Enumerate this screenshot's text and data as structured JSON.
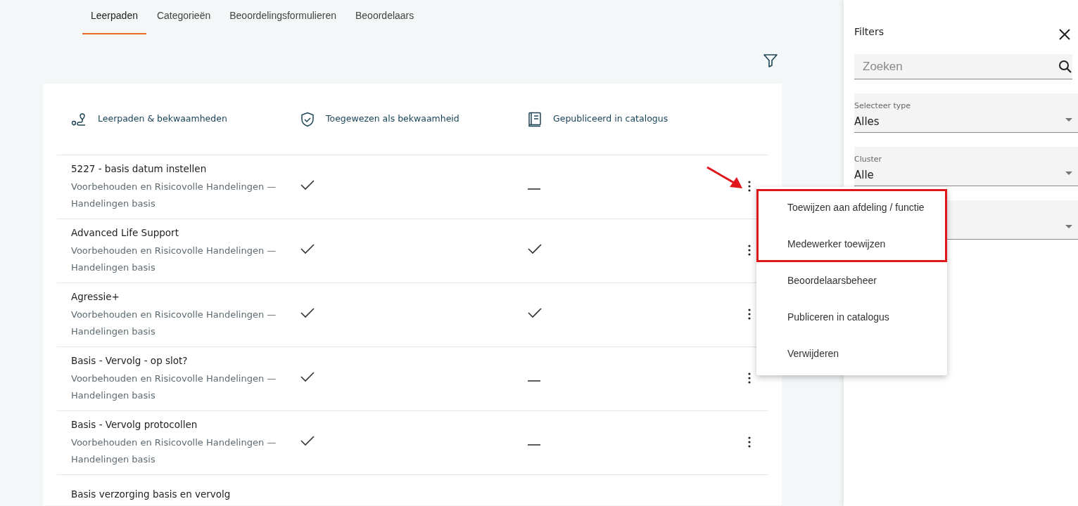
{
  "tabs": [
    {
      "label": "Leerpaden",
      "selected": true
    },
    {
      "label": "Categorieën",
      "selected": false
    },
    {
      "label": "Beoordelingsformulieren",
      "selected": false
    },
    {
      "label": "Beoordelaars",
      "selected": false
    }
  ],
  "table": {
    "columns": [
      {
        "label": "Leerpaden & bekwaamheden"
      },
      {
        "label": "Toegewezen als bekwaamheid"
      },
      {
        "label": "Gepubliceerd in catalogus"
      }
    ],
    "rows": [
      {
        "title": "5227 - basis datum instellen",
        "subtitle": "Voorbehouden en Risicovolle Handelingen — Handelingen basis",
        "assigned": true,
        "published": false,
        "context_menu": {
          "items": [
            {
              "label": "Toewijzen aan afdeling / functie",
              "highlighted": true
            },
            {
              "label": "Medewerker toewijzen",
              "highlighted": true
            },
            {
              "label": "Beoordelaarsbeheer",
              "highlighted": false
            },
            {
              "label": "Publiceren in catalogus",
              "highlighted": false
            },
            {
              "label": "Verwijderen",
              "highlighted": false
            }
          ]
        }
      },
      {
        "title": "Advanced Life Support",
        "subtitle": "Voorbehouden en Risicovolle Handelingen — Handelingen basis",
        "assigned": true,
        "published": true
      },
      {
        "title": "Agressie+",
        "subtitle": "Voorbehouden en Risicovolle Handelingen — Handelingen basis",
        "assigned": true,
        "published": true
      },
      {
        "title": "Basis - Vervolg - op slot?",
        "subtitle": "Voorbehouden en Risicovolle Handelingen — Handelingen basis",
        "assigned": true,
        "published": false
      },
      {
        "title": "Basis - Vervolg protocollen",
        "subtitle": "Voorbehouden en Risicovolle Handelingen — Handelingen basis",
        "assigned": true,
        "published": false
      },
      {
        "title": "Basis verzorging basis en vervolg"
      }
    ]
  },
  "filters": {
    "title": "Filters",
    "search": {
      "placeholder": "Zoeken"
    },
    "fields": [
      {
        "kind": "select",
        "label": "Selecteer type",
        "value": "Alles"
      },
      {
        "kind": "select",
        "label": "Cluster",
        "value": "Alle"
      },
      {
        "kind": "select"
      }
    ]
  }
}
